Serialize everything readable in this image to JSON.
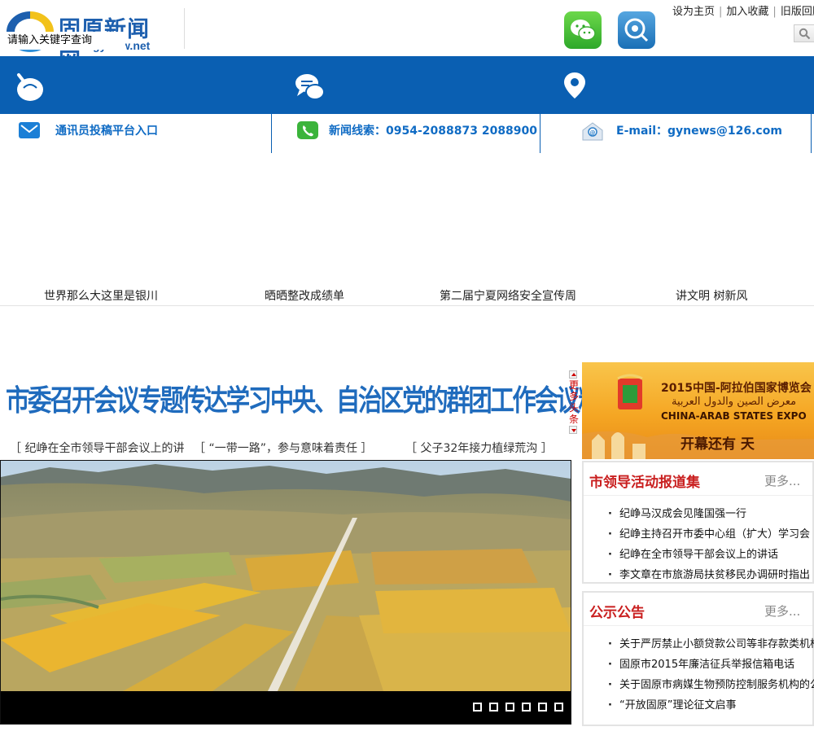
{
  "header": {
    "logo_name": "固原新闻网",
    "logo_url": "www.gyxww.net",
    "search_placeholder": "请输入关键字查询",
    "top_links": [
      "设为主页",
      "加入收藏",
      "旧版回顾"
    ],
    "qr_icons": [
      "wechat-icon",
      "weibo-icon"
    ],
    "colors": {
      "brand_blue": "#0a5fb2",
      "link_blue": "#0f6bc4",
      "accent_red": "#c91f1f"
    }
  },
  "band": {
    "icons": [
      "paperclip-icon",
      "chat-bubbles-icon",
      "location-pin-icon"
    ]
  },
  "contacts": [
    {
      "icon": "mail-icon",
      "text": "通讯员投稿平台入口"
    },
    {
      "icon": "phone-icon",
      "text": "新闻线索：0954-2088873 2088900"
    },
    {
      "icon": "email-icon",
      "text": "E-mail：gynews@126.com"
    }
  ],
  "topics": [
    "世界那么大这里是银川",
    "晒晒整改成绩单",
    "第二届宁夏网络安全宣传周",
    "讲文明 树新风"
  ],
  "headline": {
    "title": "市委召开会议专题传达学习中央、自治区党的群团工作会议精神",
    "more_label": "更多头条",
    "subheadlines": [
      "［ 纪峥在全市领导干部会议上的讲",
      "［ “一带一路”，参与意味着责任 ］",
      "［ 父子32年接力植绿荒沟 ］"
    ]
  },
  "slider": {
    "dot_count": 6,
    "active_index": 0
  },
  "expo": {
    "title": "2015中国-阿拉伯国家博览会",
    "arabic": "معرض الصين والدول العربية",
    "english": "CHINA-ARAB STATES EXPO",
    "countdown": "开幕还有    天"
  },
  "leader_box": {
    "title": "市领导活动报道集",
    "more": "更多...",
    "items": [
      "纪峥马汉成会见隆国强一行",
      "纪峥主持召开市委中心组（扩大）学习会",
      "纪峥在全市领导干部会议上的讲话",
      "李文章在市旅游局扶贫移民办调研时指出"
    ]
  },
  "notice_box": {
    "title": "公示公告",
    "more": "更多...",
    "items": [
      "关于严厉禁止小额贷款公司等非存款类机构变",
      "固原市2015年廉洁征兵举报信箱电话",
      "关于固原市病媒生物预防控制服务机构的公示",
      "“开放固原”理论征文启事"
    ]
  }
}
